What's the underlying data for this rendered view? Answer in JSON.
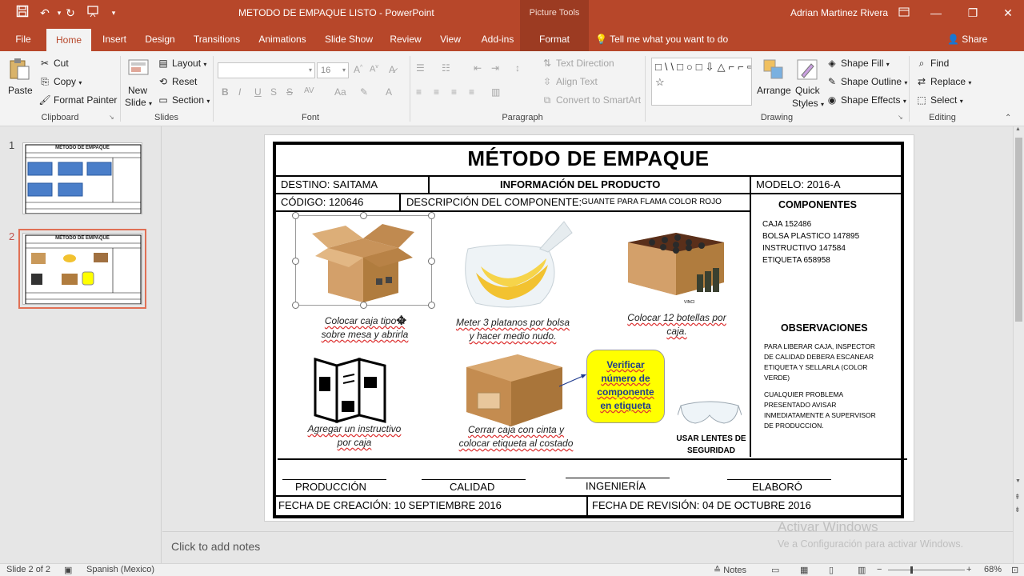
{
  "titlebar": {
    "doc_title": "METODO DE EMPAQUE LISTO - PowerPoint",
    "context_tools": "Picture Tools",
    "user": "Adrian Martinez Rivera"
  },
  "tabs": [
    {
      "label": "File"
    },
    {
      "label": "Home"
    },
    {
      "label": "Insert"
    },
    {
      "label": "Design"
    },
    {
      "label": "Transitions"
    },
    {
      "label": "Animations"
    },
    {
      "label": "Slide Show"
    },
    {
      "label": "Review"
    },
    {
      "label": "View"
    },
    {
      "label": "Add-ins"
    },
    {
      "label": "Format"
    }
  ],
  "tell_me": "Tell me what you want to do",
  "share": "Share",
  "ribbon": {
    "clipboard": {
      "paste": "Paste",
      "cut": "Cut",
      "copy": "Copy",
      "format_painter": "Format Painter",
      "label": "Clipboard"
    },
    "slides": {
      "new_slide_1": "New",
      "new_slide_2": "Slide",
      "layout": "Layout",
      "reset": "Reset",
      "section": "Section",
      "label": "Slides"
    },
    "font": {
      "size": "16",
      "label": "Font",
      "bold": "B",
      "italic": "I",
      "underline": "U",
      "strike": "S"
    },
    "paragraph": {
      "text_direction": "Text Direction",
      "align_text": "Align Text",
      "convert_smartart": "Convert to SmartArt",
      "label": "Paragraph"
    },
    "drawing": {
      "arrange": "Arrange",
      "quick_styles_1": "Quick",
      "quick_styles_2": "Styles",
      "shape_fill": "Shape Fill",
      "shape_outline": "Shape Outline",
      "shape_effects": "Shape Effects",
      "label": "Drawing",
      "gallery": "□\\\\□○□⇩△⌐⌐⇨⇧◯⌒⌒{}☆"
    },
    "editing": {
      "find": "Find",
      "replace": "Replace",
      "select": "Select",
      "label": "Editing"
    }
  },
  "thumbnails": [
    {
      "num": "1",
      "title": "MÉTODO DE EMPAQUE"
    },
    {
      "num": "2",
      "title": "MÉTODO DE EMPAQUE"
    }
  ],
  "slide": {
    "title": "MÉTODO DE EMPAQUE",
    "destino": "DESTINO: SAITAMA",
    "info_producto": "INFORMACIÓN DEL PRODUCTO",
    "modelo": "MODELO: 2016-A",
    "codigo": "CÓDIGO: 120646",
    "descripcion_label": "DESCRIPCIÓN DEL COMPONENTE:",
    "descripcion_value": "GUANTE PARA FLAMA COLOR ROJO",
    "componentes_head": "COMPONENTES",
    "componentes": [
      "CAJA 152486",
      "BOLSA PLASTICO 147895",
      "INSTRUCTIVO 147584",
      "ETIQUETA 658958"
    ],
    "observaciones_head": "OBSERVACIONES",
    "observacion_1": "PARA LIBERAR CAJA, INSPECTOR DE CALIDAD DEBERA ESCANEAR ETIQUETA Y SELLARLA (COLOR VERDE)",
    "observacion_2": "CUALQUIER PROBLEMA PRESENTADO AVISAR INMEDIATAMENTE A SUPERVISOR DE PRODUCCION.",
    "step1_l1": "Colocar caja tipo A",
    "step1_l2": "sobre mesa y abrirla",
    "step2_l1": "Meter 3 platanos por bolsa",
    "step2_l2": "y hacer medio nudo.",
    "step3_l1": "Colocar 12 botellas por",
    "step3_l2": "caja.",
    "step4_l1": "Agregar un instructivo",
    "step4_l2": "por caja",
    "step5_l1": "Cerrar caja con cinta y",
    "step5_l2": "colocar etiqueta al costado",
    "callout_l1": "Verificar",
    "callout_l2": "número de",
    "callout_l3": "componente",
    "callout_l4": "en etiqueta",
    "lentes_l1": "USAR LENTES DE",
    "lentes_l2": "SEGURIDAD",
    "sign_produccion": "PRODUCCIÓN",
    "sign_calidad": "CALIDAD",
    "sign_ingenieria": "INGENIERÍA",
    "sign_elaboro": "ELABORÓ",
    "fecha_creacion": "FECHA DE CREACIÓN: 10 SEPTIEMBRE 2016",
    "fecha_revision": "FECHA DE REVISIÓN: 04 DE OCTUBRE 2016",
    "bottle_brand": "VINCI"
  },
  "notes_placeholder": "Click to add notes",
  "watermark": {
    "line1": "Activar Windows",
    "line2": "Ve a Configuración para activar Windows."
  },
  "status": {
    "slide": "Slide 2 of 2",
    "language": "Spanish (Mexico)",
    "notes": "Notes",
    "zoom": "68%"
  },
  "colors": {
    "accent": "#b7472a",
    "accent_dark": "#9c3b22",
    "callout": "#ffff00",
    "callout_text": "#1f3b8f"
  }
}
